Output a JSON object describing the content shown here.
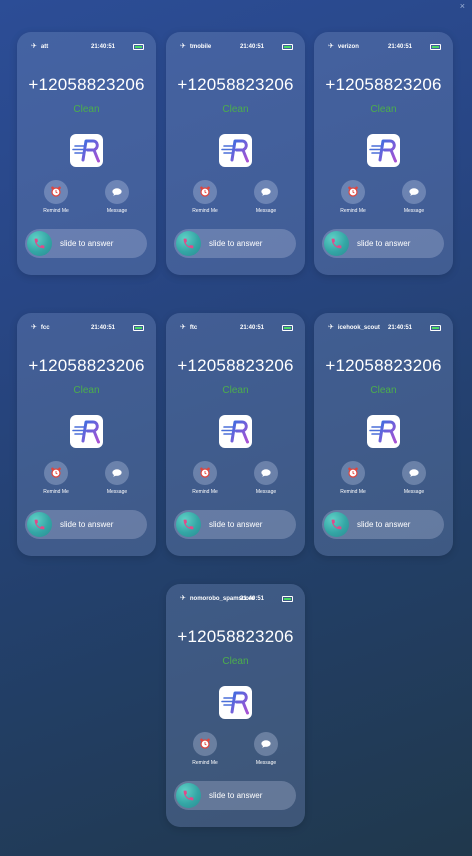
{
  "window": {
    "close_glyph": "×"
  },
  "cards": [
    {
      "carrier": "att",
      "time": "21:40:51",
      "number": "+12058823206",
      "status": "Clean",
      "remind_label": "Remind Me",
      "message_label": "Message",
      "slider_label": "slide to answer"
    },
    {
      "carrier": "tmobile",
      "time": "21:40:51",
      "number": "+12058823206",
      "status": "Clean",
      "remind_label": "Remind Me",
      "message_label": "Message",
      "slider_label": "slide to answer"
    },
    {
      "carrier": "verizon",
      "time": "21:40:51",
      "number": "+12058823206",
      "status": "Clean",
      "remind_label": "Remind Me",
      "message_label": "Message",
      "slider_label": "slide to answer"
    },
    {
      "carrier": "fcc",
      "time": "21:40:51",
      "number": "+12058823206",
      "status": "Clean",
      "remind_label": "Remind Me",
      "message_label": "Message",
      "slider_label": "slide to answer"
    },
    {
      "carrier": "ftc",
      "time": "21:40:51",
      "number": "+12058823206",
      "status": "Clean",
      "remind_label": "Remind Me",
      "message_label": "Message",
      "slider_label": "slide to answer"
    },
    {
      "carrier": "icehook_scout",
      "time": "21:40:51",
      "number": "+12058823206",
      "status": "Clean",
      "remind_label": "Remind Me",
      "message_label": "Message",
      "slider_label": "slide to answer"
    },
    {
      "carrier": "nomorobo_spamscore",
      "time": "21:40:51",
      "number": "+12058823206",
      "status": "Clean",
      "remind_label": "Remind Me",
      "message_label": "Message",
      "slider_label": "slide to answer"
    }
  ],
  "icons": {
    "status_left": "airplane-icon",
    "battery": "battery-icon",
    "app": "app-logo-icon",
    "remind": "alarm-clock-icon",
    "message": "chat-bubble-icon",
    "slider": "phone-icon"
  },
  "colors": {
    "status_clean": "#4cae4c",
    "battery_fill": "#4cd964",
    "slider_knob": "#34a6a5",
    "logo_blue": "#4a6fd8",
    "logo_purple": "#a05ad6"
  }
}
